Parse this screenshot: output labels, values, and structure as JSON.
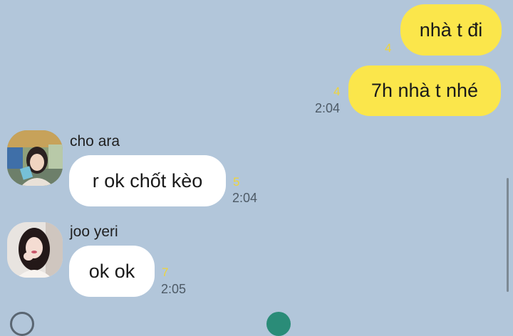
{
  "messages_out": [
    {
      "text": "nhà t đi",
      "unread": "4",
      "time": ""
    },
    {
      "text": "7h nhà t nhé",
      "unread": "4",
      "time": "2:04"
    }
  ],
  "messages_in": [
    {
      "sender": "cho ara",
      "text": "r ok chốt kèo",
      "unread": "5",
      "time": "2:04",
      "avatar_icon": "avatar-cho-ara"
    },
    {
      "sender": "joo yeri",
      "text": "ok ok",
      "unread": "7",
      "time": "2:05",
      "avatar_icon": "avatar-joo-yeri"
    }
  ],
  "colors": {
    "background": "#b2c6da",
    "outgoing_bubble": "#fbe64b",
    "incoming_bubble": "#ffffff",
    "unread_count": "#efd43a"
  }
}
